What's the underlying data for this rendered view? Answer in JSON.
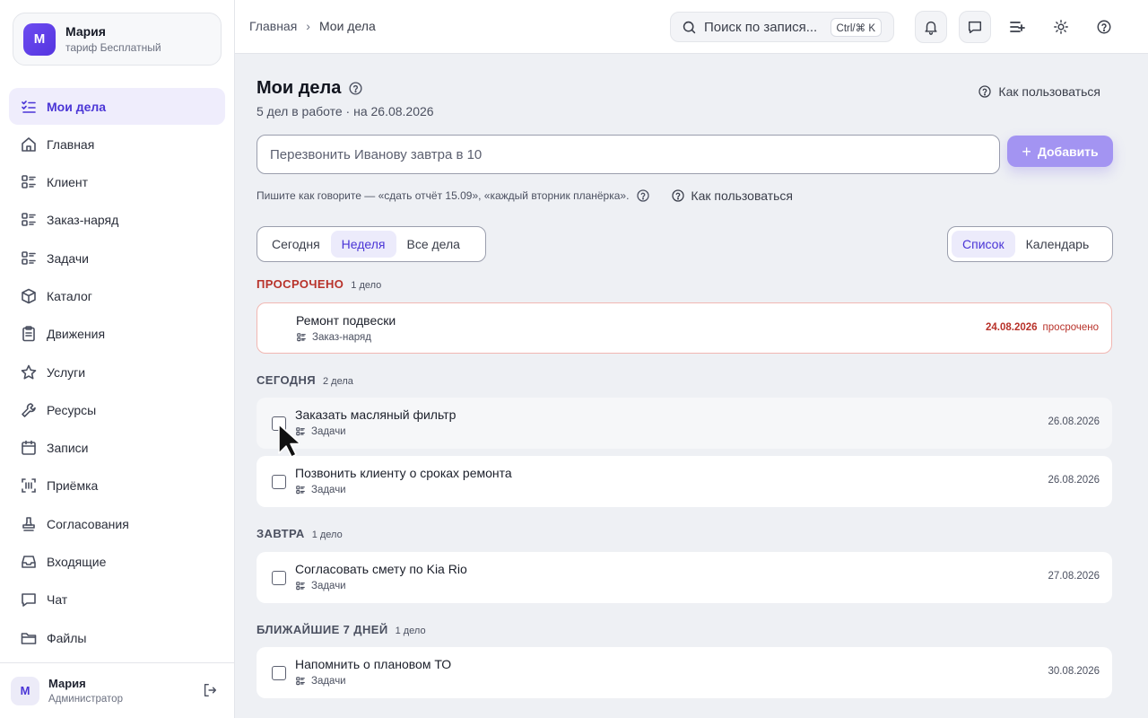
{
  "profile": {
    "initial": "М",
    "name": "Мария",
    "plan": "тариф Бесплатный"
  },
  "nav": [
    {
      "label": "Мои дела",
      "icon": "list-check-icon",
      "active": true
    },
    {
      "label": "Главная",
      "icon": "home-icon"
    },
    {
      "label": "Клиент",
      "icon": "list-grid-icon"
    },
    {
      "label": "Заказ-наряд",
      "icon": "list-grid-icon"
    },
    {
      "label": "Задачи",
      "icon": "list-grid-icon"
    },
    {
      "label": "Каталог",
      "icon": "box-icon"
    },
    {
      "label": "Движения",
      "icon": "clipboard-icon"
    },
    {
      "label": "Услуги",
      "icon": "star-icon"
    },
    {
      "label": "Ресурсы",
      "icon": "wrench-icon"
    },
    {
      "label": "Записи",
      "icon": "calendar-icon"
    },
    {
      "label": "Приёмка",
      "icon": "scan-icon"
    },
    {
      "label": "Согласования",
      "icon": "stamp-icon"
    },
    {
      "label": "Входящие",
      "icon": "inbox-icon"
    },
    {
      "label": "Чат",
      "icon": "chat-icon"
    },
    {
      "label": "Файлы",
      "icon": "folder-icon"
    }
  ],
  "footer_user": {
    "initial": "М",
    "name": "Мария",
    "role": "Администратор"
  },
  "breadcrumb": {
    "home": "Главная",
    "separator": "›",
    "current": "Мои дела"
  },
  "search": {
    "placeholder": "Поиск по запися...",
    "shortcut": "Ctrl/⌘ K"
  },
  "page": {
    "title": "Мои дела",
    "subtitle": "5 дел в работе · на 26.08.2026",
    "howto_label": "Как пользоваться"
  },
  "quick_add": {
    "placeholder": "Перезвонить Иванову завтра в 10",
    "button_label": "Добавить",
    "hint": "Пишите как говорите — «сдать отчёт 15.09», «каждый вторник планёрка».",
    "howto_label": "Как пользоваться"
  },
  "filters": {
    "period": [
      "Сегодня",
      "Неделя",
      "Все дела"
    ],
    "period_active": "Неделя",
    "view": [
      "Список",
      "Календарь"
    ],
    "view_active": "Список"
  },
  "groups": {
    "overdue": {
      "title": "ПРОСРОЧЕНО",
      "count": "1 дело"
    },
    "today": {
      "title": "СЕГОДНЯ",
      "count": "2 дела"
    },
    "tomorrow": {
      "title": "ЗАВТРА",
      "count": "1 дело"
    },
    "week": {
      "title": "БЛИЖАЙШИЕ 7 ДНЕЙ",
      "count": "1 дело"
    }
  },
  "tasks": {
    "overdue": [
      {
        "title": "Ремонт подвески",
        "source": "Заказ-наряд",
        "date": "24.08.2026",
        "status": "просрочено"
      }
    ],
    "today": [
      {
        "title": "Заказать масляный фильтр",
        "source": "Задачи",
        "date": "26.08.2026"
      },
      {
        "title": "Позвонить клиенту о сроках ремонта",
        "source": "Задачи",
        "date": "26.08.2026"
      }
    ],
    "tomorrow": [
      {
        "title": "Согласовать смету по Kia Rio",
        "source": "Задачи",
        "date": "27.08.2026"
      }
    ],
    "week": [
      {
        "title": "Напомнить о плановом ТО",
        "source": "Задачи",
        "date": "30.08.2026"
      }
    ]
  },
  "colors": {
    "accent": "#4a35d6",
    "accent_soft": "#efedfc",
    "add_button": "#a394f2",
    "overdue": "#b8322a"
  }
}
